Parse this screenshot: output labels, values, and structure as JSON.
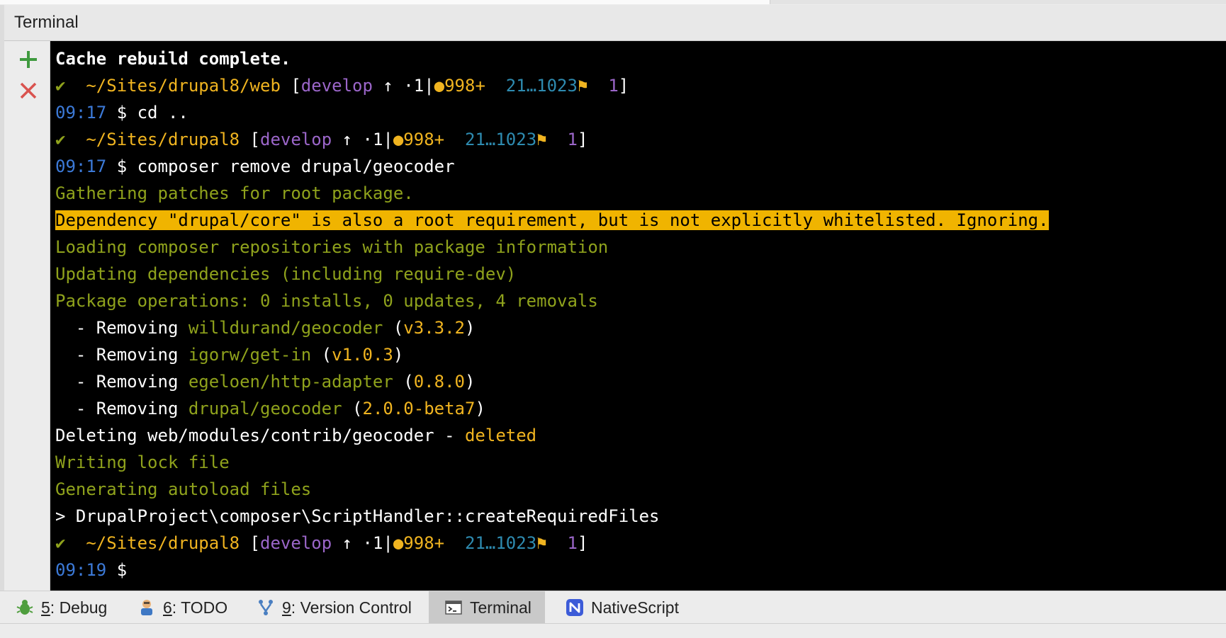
{
  "window": {
    "panel_title": "Terminal"
  },
  "toolbar": {
    "add_label": "+",
    "close_label": "✕"
  },
  "terminal": {
    "lines": [
      {
        "segments": [
          {
            "t": "Cache rebuild complete.",
            "c": "bw"
          }
        ]
      },
      {
        "segments": [
          {
            "t": "✔  ",
            "c": "g"
          },
          {
            "t": "~/Sites/drupal8/web ",
            "c": "y"
          },
          {
            "t": "[",
            "c": "w"
          },
          {
            "t": "develop",
            "c": "p"
          },
          {
            "t": " ↑ ·1|",
            "c": "w"
          },
          {
            "t": "●998+",
            "c": "y"
          },
          {
            "t": "  21…1023",
            "c": "c"
          },
          {
            "t": "⚑",
            "c": "y"
          },
          {
            "t": "  ",
            "c": "w"
          },
          {
            "t": "1",
            "c": "p"
          },
          {
            "t": "]",
            "c": "w"
          }
        ]
      },
      {
        "segments": [
          {
            "t": "09:17",
            "c": "b"
          },
          {
            "t": " $ cd ..",
            "c": "w"
          }
        ]
      },
      {
        "segments": [
          {
            "t": "✔  ",
            "c": "g"
          },
          {
            "t": "~/Sites/drupal8 ",
            "c": "y"
          },
          {
            "t": "[",
            "c": "w"
          },
          {
            "t": "develop",
            "c": "p"
          },
          {
            "t": " ↑ ·1|",
            "c": "w"
          },
          {
            "t": "●998+",
            "c": "y"
          },
          {
            "t": "  21…1023",
            "c": "c"
          },
          {
            "t": "⚑",
            "c": "y"
          },
          {
            "t": "  ",
            "c": "w"
          },
          {
            "t": "1",
            "c": "p"
          },
          {
            "t": "]",
            "c": "w"
          }
        ]
      },
      {
        "segments": [
          {
            "t": "09:17",
            "c": "b"
          },
          {
            "t": " $ composer remove drupal/geocoder",
            "c": "w"
          }
        ]
      },
      {
        "segments": [
          {
            "t": "Gathering patches for root package.",
            "c": "g"
          }
        ]
      },
      {
        "segments": [
          {
            "t": "Dependency \"drupal/core\" is also a root requirement, but is not explicitly whitelisted. Ignoring.",
            "c": "hl"
          }
        ]
      },
      {
        "segments": [
          {
            "t": "Loading composer repositories with package information",
            "c": "g"
          }
        ]
      },
      {
        "segments": [
          {
            "t": "Updating dependencies (including require-dev)",
            "c": "g"
          }
        ]
      },
      {
        "segments": [
          {
            "t": "Package operations: 0 installs, 0 updates, 4 removals",
            "c": "g"
          }
        ]
      },
      {
        "segments": [
          {
            "t": "  - Removing ",
            "c": "w"
          },
          {
            "t": "willdurand/geocoder",
            "c": "g"
          },
          {
            "t": " (",
            "c": "w"
          },
          {
            "t": "v3.3.2",
            "c": "y"
          },
          {
            "t": ")",
            "c": "w"
          }
        ]
      },
      {
        "segments": [
          {
            "t": "  - Removing ",
            "c": "w"
          },
          {
            "t": "igorw/get-in",
            "c": "g"
          },
          {
            "t": " (",
            "c": "w"
          },
          {
            "t": "v1.0.3",
            "c": "y"
          },
          {
            "t": ")",
            "c": "w"
          }
        ]
      },
      {
        "segments": [
          {
            "t": "  - Removing ",
            "c": "w"
          },
          {
            "t": "egeloen/http-adapter",
            "c": "g"
          },
          {
            "t": " (",
            "c": "w"
          },
          {
            "t": "0.8.0",
            "c": "y"
          },
          {
            "t": ")",
            "c": "w"
          }
        ]
      },
      {
        "segments": [
          {
            "t": "  - Removing ",
            "c": "w"
          },
          {
            "t": "drupal/geocoder",
            "c": "g"
          },
          {
            "t": " (",
            "c": "w"
          },
          {
            "t": "2.0.0-beta7",
            "c": "y"
          },
          {
            "t": ")",
            "c": "w"
          }
        ]
      },
      {
        "segments": [
          {
            "t": "Deleting web/modules/contrib/geocoder - ",
            "c": "w"
          },
          {
            "t": "deleted",
            "c": "y"
          }
        ]
      },
      {
        "segments": [
          {
            "t": "Writing lock file",
            "c": "g"
          }
        ]
      },
      {
        "segments": [
          {
            "t": "Generating autoload files",
            "c": "g"
          }
        ]
      },
      {
        "segments": [
          {
            "t": "> DrupalProject\\composer\\ScriptHandler::createRequiredFiles",
            "c": "w"
          }
        ]
      },
      {
        "segments": [
          {
            "t": "✔  ",
            "c": "g"
          },
          {
            "t": "~/Sites/drupal8 ",
            "c": "y"
          },
          {
            "t": "[",
            "c": "w"
          },
          {
            "t": "develop",
            "c": "p"
          },
          {
            "t": " ↑ ·1|",
            "c": "w"
          },
          {
            "t": "●998+",
            "c": "y"
          },
          {
            "t": "  21…1023",
            "c": "c"
          },
          {
            "t": "⚑",
            "c": "y"
          },
          {
            "t": "  ",
            "c": "w"
          },
          {
            "t": "1",
            "c": "p"
          },
          {
            "t": "]",
            "c": "w"
          }
        ]
      },
      {
        "segments": [
          {
            "t": "09:19",
            "c": "b"
          },
          {
            "t": " $",
            "c": "w"
          }
        ]
      }
    ]
  },
  "bottom_tabs": [
    {
      "num": "5",
      "label": ": Debug",
      "icon": "bug-icon"
    },
    {
      "num": "6",
      "label": ": TODO",
      "icon": "todo-icon"
    },
    {
      "num": "9",
      "label": ": Version Control",
      "icon": "version-control-icon"
    },
    {
      "num": "",
      "label": "Terminal",
      "icon": "terminal-icon"
    },
    {
      "num": "",
      "label": "NativeScript",
      "icon": "nativescript-icon"
    }
  ],
  "colors": {
    "terminal_bg": "#000000",
    "highlight": "#f0b400",
    "green": "#8fa21c",
    "yellow": "#f0b420",
    "purple": "#9b66c9",
    "blue": "#3c7ad8"
  }
}
